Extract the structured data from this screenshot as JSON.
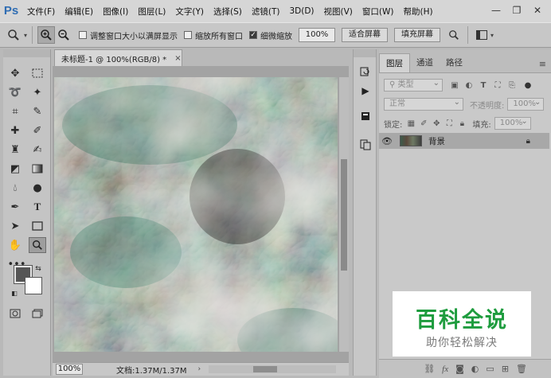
{
  "app": {
    "logo": "Ps"
  },
  "menu": {
    "items": [
      "文件(F)",
      "编辑(E)",
      "图像(I)",
      "图层(L)",
      "文字(Y)",
      "选择(S)",
      "滤镜(T)",
      "3D(D)",
      "视图(V)",
      "窗口(W)",
      "帮助(H)"
    ]
  },
  "window_controls": {
    "minimize": "—",
    "restore": "❐",
    "close": "✕"
  },
  "options": {
    "resize_windows_label": "调整窗口大小以满屏显示",
    "resize_windows_checked": false,
    "zoom_all_label": "缩放所有窗口",
    "zoom_all_checked": false,
    "scrubby_zoom_label": "细微缩放",
    "scrubby_zoom_checked": true,
    "zoom_value": "100%",
    "fit_screen_label": "适合屏幕",
    "fill_screen_label": "填充屏幕"
  },
  "document": {
    "tab_title": "未标题-1 @ 100%(RGB/8) *",
    "close_glyph": "×",
    "zoom": "100%",
    "doc_info": "文档:1.37M/1.37M"
  },
  "colors": {
    "foreground": "#555555",
    "background": "#ffffff",
    "watermark_green": "#1e9c3e"
  },
  "layers_panel": {
    "tabs": [
      "图层",
      "通道",
      "路径"
    ],
    "active_tab": 0,
    "filter_kind": "类型",
    "blend_mode": "正常",
    "opacity_label": "不透明度:",
    "opacity_value": "100%",
    "lock_label": "锁定:",
    "fill_label": "填充:",
    "fill_value": "100%",
    "layers": [
      {
        "name": "背景",
        "visible": true,
        "locked": true
      }
    ]
  },
  "watermark": {
    "title": "百科全说",
    "subtitle": "助你轻松解决"
  }
}
